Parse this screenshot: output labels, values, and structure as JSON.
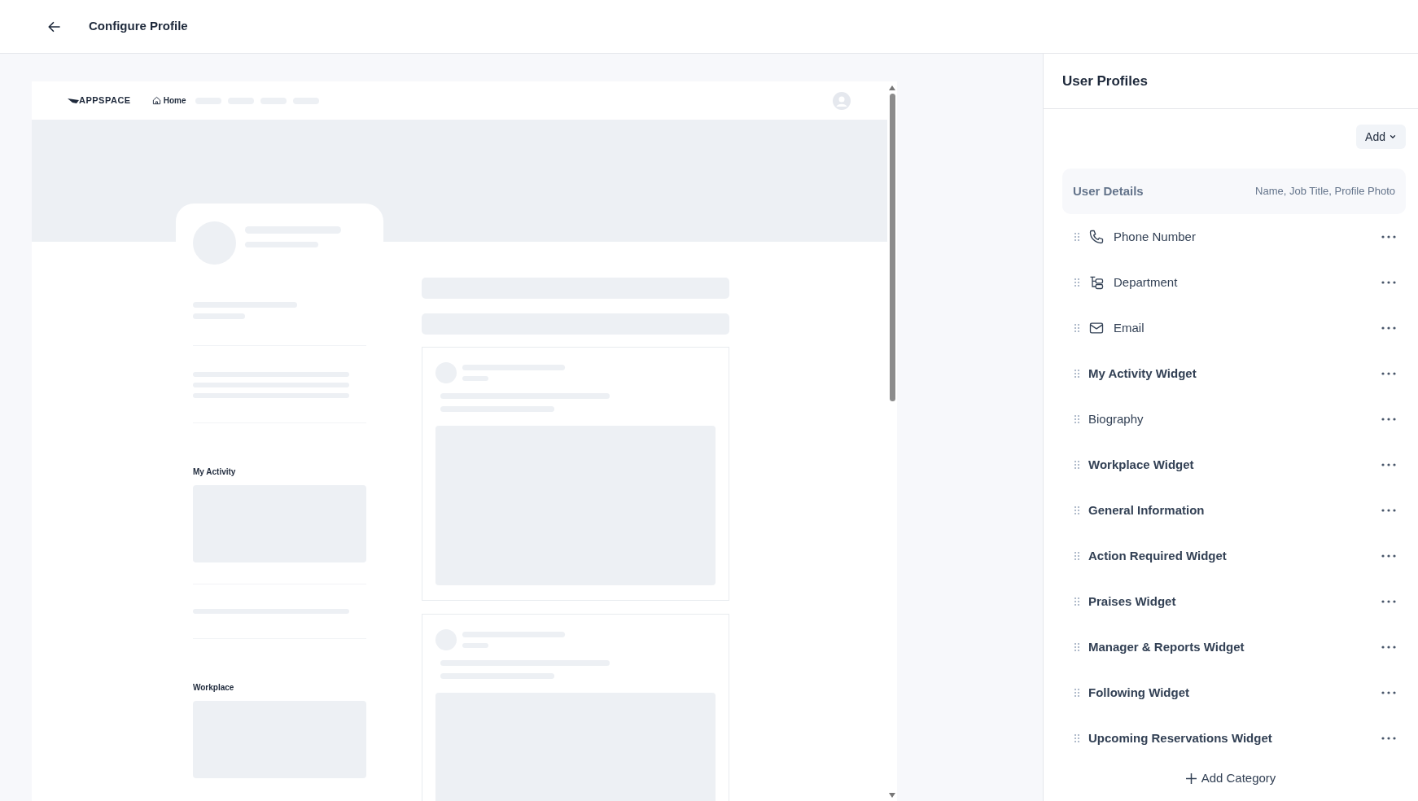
{
  "header": {
    "title": "Configure Profile"
  },
  "preview": {
    "logo": "APPSPACE",
    "nav_home": "Home",
    "sections": [
      "My Activity",
      "Workplace"
    ]
  },
  "panel": {
    "title": "User Profiles",
    "add_button": "Add",
    "user_details": {
      "label": "User Details",
      "fields": "Name, Job Title, Profile Photo"
    },
    "items": [
      {
        "kind": "phone",
        "label": "Phone Number"
      },
      {
        "kind": "department",
        "label": "Department"
      },
      {
        "kind": "email",
        "label": "Email"
      },
      {
        "kind": "widget",
        "label": "My Activity Widget"
      },
      {
        "kind": "plain",
        "label": "Biography"
      },
      {
        "kind": "widget",
        "label": "Workplace Widget"
      },
      {
        "kind": "widget",
        "label": "General Information"
      },
      {
        "kind": "widget",
        "label": "Action Required Widget"
      },
      {
        "kind": "widget",
        "label": "Praises Widget"
      },
      {
        "kind": "widget",
        "label": "Manager & Reports Widget"
      },
      {
        "kind": "widget",
        "label": "Following Widget"
      },
      {
        "kind": "widget",
        "label": "Upcoming Reservations Widget"
      }
    ],
    "add_category": "Add Category"
  }
}
